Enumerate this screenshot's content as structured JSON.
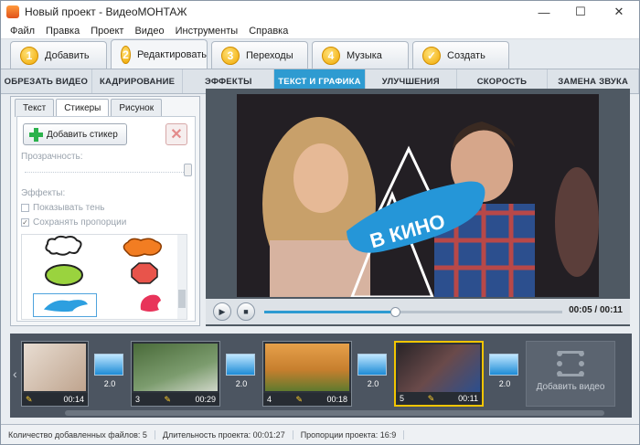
{
  "window": {
    "title": "Новый проект - ВидеоМОНТАЖ",
    "minimize": "—",
    "maximize": "☐",
    "close": "✕"
  },
  "menu": [
    "Файл",
    "Правка",
    "Проект",
    "Видео",
    "Инструменты",
    "Справка"
  ],
  "steps": [
    {
      "num": "1",
      "label": "Добавить"
    },
    {
      "num": "2",
      "label": "Редактировать"
    },
    {
      "num": "3",
      "label": "Переходы"
    },
    {
      "num": "4",
      "label": "Музыка"
    },
    {
      "num": "✓",
      "label": "Создать"
    }
  ],
  "toolbar": [
    "ОБРЕЗАТЬ ВИДЕО",
    "КАДРИРОВАНИЕ",
    "ЭФФЕКТЫ",
    "ТЕКСТ И ГРАФИКА",
    "УЛУЧШЕНИЯ",
    "СКОРОСТЬ",
    "ЗАМЕНА ЗВУКА"
  ],
  "left": {
    "tabs": [
      "Текст",
      "Стикеры",
      "Рисунок"
    ],
    "add_sticker": "Добавить стикер",
    "transparency": "Прозрачность:",
    "effects": "Эффекты:",
    "show_shadow": "Показывать тень",
    "keep_proportions": "Сохранять пропорции"
  },
  "preview": {
    "caption": "В КИНО",
    "time": "00:05 / 00:11",
    "progress": 0.44
  },
  "clips": [
    {
      "n": "",
      "dur": "00:14"
    },
    {
      "n": "3",
      "dur": "00:29"
    },
    {
      "n": "4",
      "dur": "00:18"
    },
    {
      "n": "5",
      "dur": "00:11"
    }
  ],
  "transitions": [
    "2.0",
    "2.0",
    "2.0",
    "2.0"
  ],
  "add_video": "Добавить видео",
  "status": {
    "files": "Количество добавленных файлов: 5",
    "duration": "Длительность проекта:  00:01:27",
    "ratio": "Пропорции проекта:  16:9"
  },
  "colors": {
    "accent": "#2e9bd1",
    "step_badge": "#f0a800",
    "selected_clip": "#f2c500"
  }
}
